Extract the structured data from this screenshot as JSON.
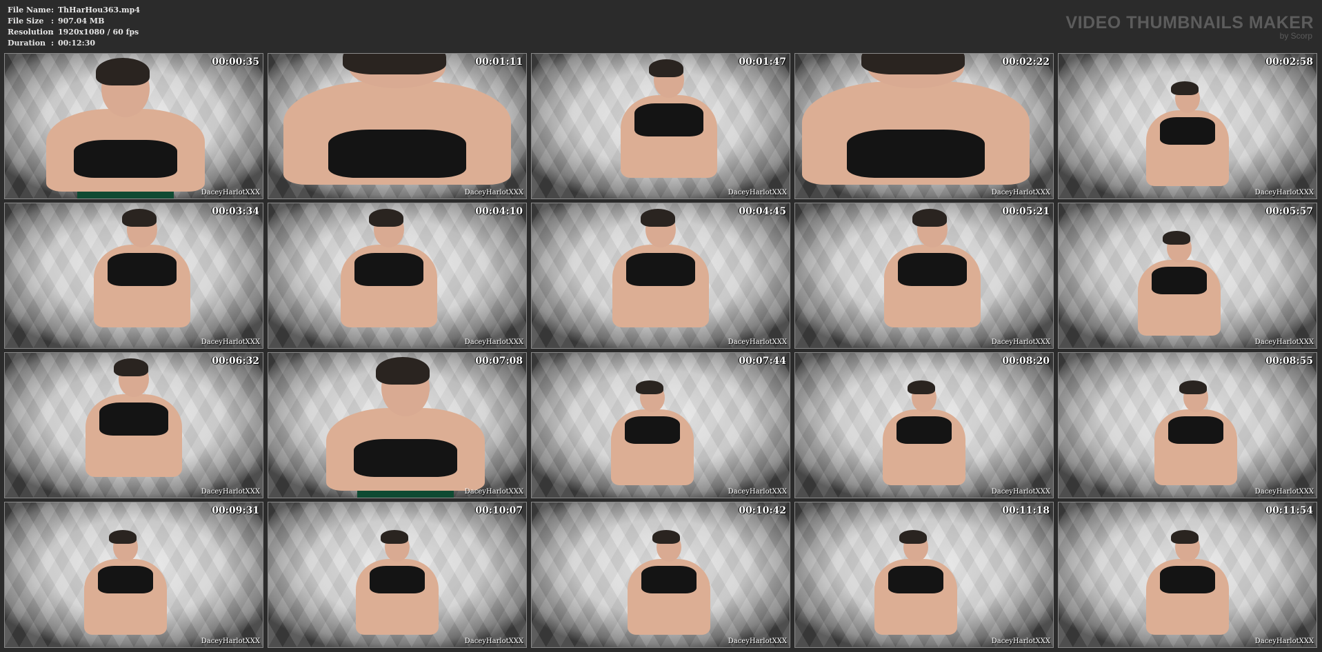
{
  "file_info": {
    "rows": [
      {
        "key": "File Name",
        "sep": ":",
        "value": "ThHarHou363.mp4"
      },
      {
        "key": "File Size",
        "sep": ":",
        "value": "907.04 MB"
      },
      {
        "key": "Resolution",
        "sep": ":",
        "value": "1920x1080 / 60 fps"
      },
      {
        "key": "Duration",
        "sep": ":",
        "value": "00:12:30"
      }
    ]
  },
  "brand": {
    "title": "VIDEO THUMBNAILS MAKER",
    "subtitle": "by Scorp"
  },
  "watermark": "DaceyHarlotXXX",
  "thumbnails": [
    {
      "time": "00:00:35",
      "pose": "close"
    },
    {
      "time": "00:01:11",
      "pose": "closer"
    },
    {
      "time": "00:01:47",
      "pose": "mid"
    },
    {
      "time": "00:02:22",
      "pose": "closer"
    },
    {
      "time": "00:02:58",
      "pose": "far"
    },
    {
      "time": "00:03:34",
      "pose": "mid"
    },
    {
      "time": "00:04:10",
      "pose": "mid"
    },
    {
      "time": "00:04:45",
      "pose": "mid"
    },
    {
      "time": "00:05:21",
      "pose": "mid"
    },
    {
      "time": "00:05:57",
      "pose": "far"
    },
    {
      "time": "00:06:32",
      "pose": "mid"
    },
    {
      "time": "00:07:08",
      "pose": "close"
    },
    {
      "time": "00:07:44",
      "pose": "far"
    },
    {
      "time": "00:08:20",
      "pose": "far"
    },
    {
      "time": "00:08:55",
      "pose": "far"
    },
    {
      "time": "00:09:31",
      "pose": "far"
    },
    {
      "time": "00:10:07",
      "pose": "far"
    },
    {
      "time": "00:10:42",
      "pose": "far"
    },
    {
      "time": "00:11:18",
      "pose": "far"
    },
    {
      "time": "00:11:54",
      "pose": "far"
    }
  ]
}
